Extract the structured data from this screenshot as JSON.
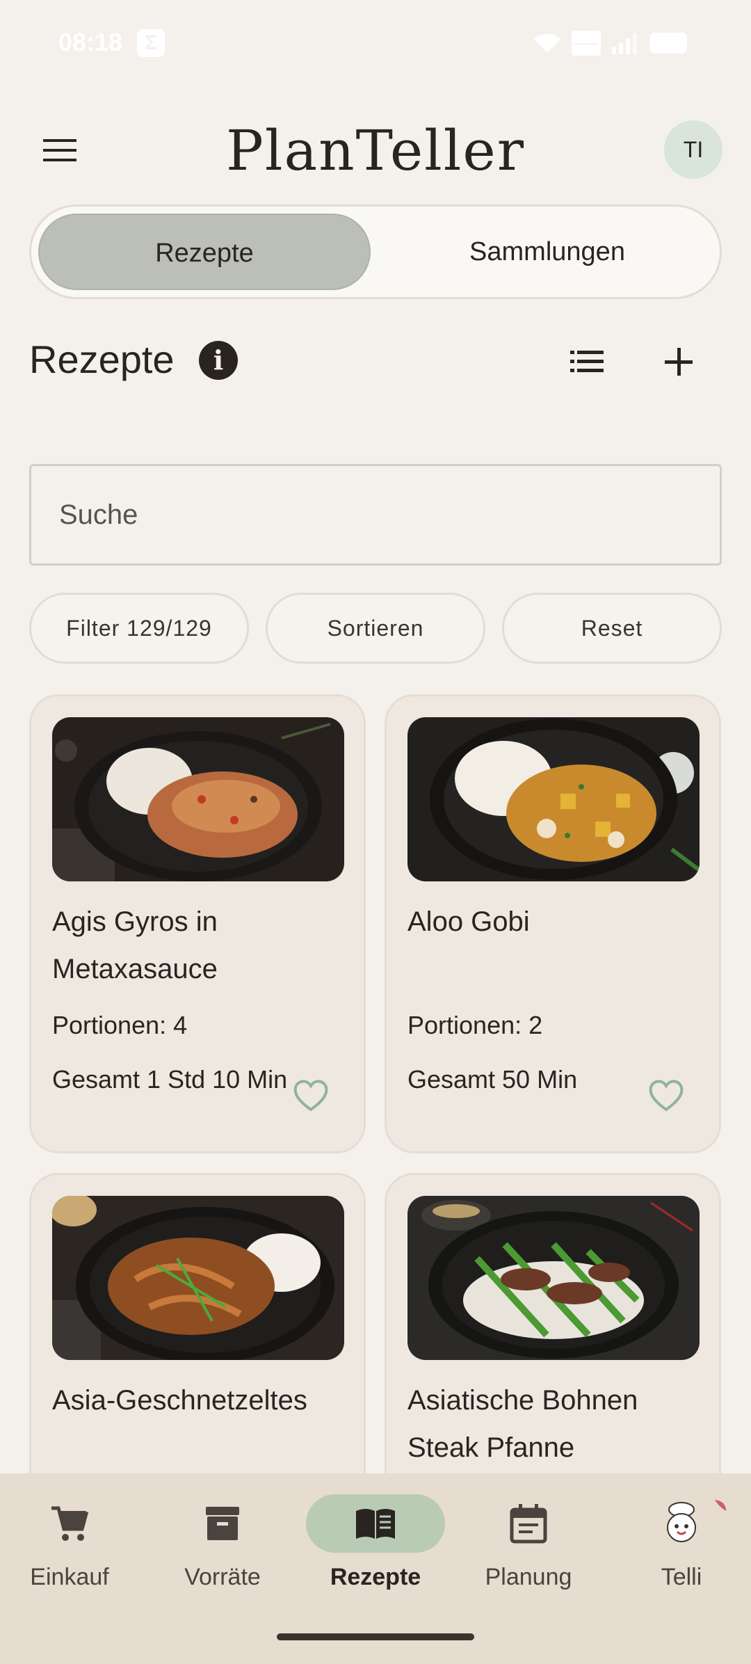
{
  "status_bar": {
    "time": "08:18",
    "notification_icon": "sigma-icon",
    "icons": [
      "wifi-icon",
      "volte-icon",
      "signal-icon",
      "battery-icon"
    ]
  },
  "app_bar": {
    "title": "PlanTeller",
    "avatar_initials": "TI",
    "menu_icon": "menu-icon"
  },
  "tabs": {
    "active": "Rezepte",
    "inactive": "Sammlungen"
  },
  "section": {
    "title": "Rezepte",
    "info_icon": "info-icon",
    "list_icon": "list-view-icon",
    "add_icon": "plus-icon"
  },
  "search": {
    "placeholder": "Suche"
  },
  "chips": {
    "filter": "Filter 129/129",
    "sort": "Sortieren",
    "reset": "Reset"
  },
  "recipes": [
    {
      "title": "Agis Gyros in Metaxasauce",
      "portions": "Portionen: 4",
      "total": "Gesamt 1 Std 10 Min",
      "favorite": false
    },
    {
      "title": "Aloo Gobi",
      "portions": "Portionen: 2",
      "total": "Gesamt 50 Min",
      "favorite": false
    },
    {
      "title": "Asia-Geschnetzeltes",
      "portions": "",
      "total": "",
      "favorite": false
    },
    {
      "title": "Asiatische Bohnen Steak Pfanne",
      "portions": "",
      "total": "",
      "favorite": false
    }
  ],
  "bottom_nav": [
    {
      "label": "Einkauf",
      "icon": "cart-icon",
      "active": false
    },
    {
      "label": "Vorräte",
      "icon": "archive-icon",
      "active": false
    },
    {
      "label": "Rezepte",
      "icon": "recipe-book-icon",
      "active": true
    },
    {
      "label": "Planung",
      "icon": "calendar-icon",
      "active": false
    },
    {
      "label": "Telli",
      "icon": "chef-mascot-icon",
      "active": false
    }
  ],
  "colors": {
    "background": "#f4f1ec",
    "card": "#efe8e0",
    "accent": "#b9cbb4",
    "heart": "#8fb49a",
    "nav": "#e6dcd0"
  }
}
